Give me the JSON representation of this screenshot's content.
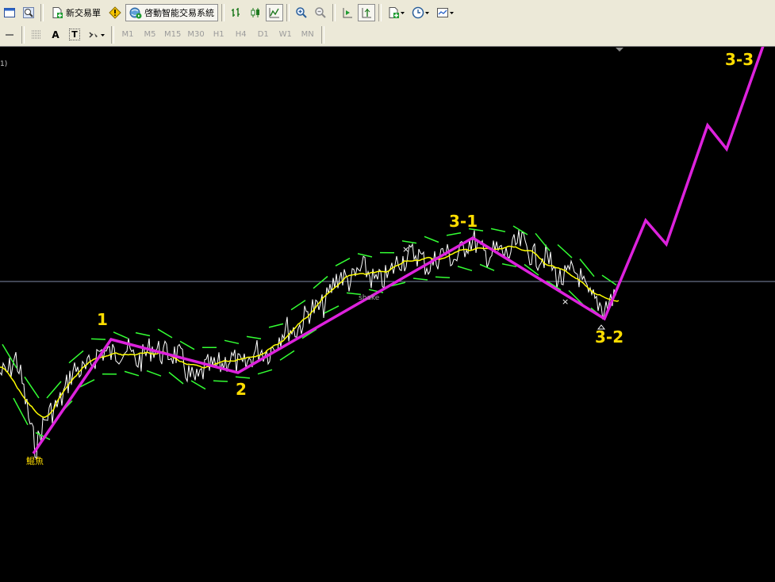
{
  "toolbar": {
    "new_order_label": "新交易單",
    "expert_advisors_label": "啓動智能交易系統",
    "timeframes": [
      "M1",
      "M5",
      "M15",
      "M30",
      "H1",
      "H4",
      "D1",
      "W1",
      "MN"
    ],
    "text_tool_label": "A",
    "text_label_tool_label": "T"
  },
  "chart": {
    "side_label": "1)",
    "wave_labels": [
      {
        "text": "1"
      },
      {
        "text": "2"
      },
      {
        "text": "3-1"
      },
      {
        "text": "3-2"
      },
      {
        "text": "3-3"
      }
    ],
    "annotations": [
      {
        "text": "鯤魚"
      },
      {
        "text": "shake"
      }
    ],
    "colors": {
      "background": "#000000",
      "price_line": "#ffffff",
      "moving_average": "#ffff00",
      "bands": "#33ff33",
      "wave_line": "#dd22dd",
      "wave_label": "#ffdd00",
      "crosshair": "#7f8aa8"
    }
  }
}
